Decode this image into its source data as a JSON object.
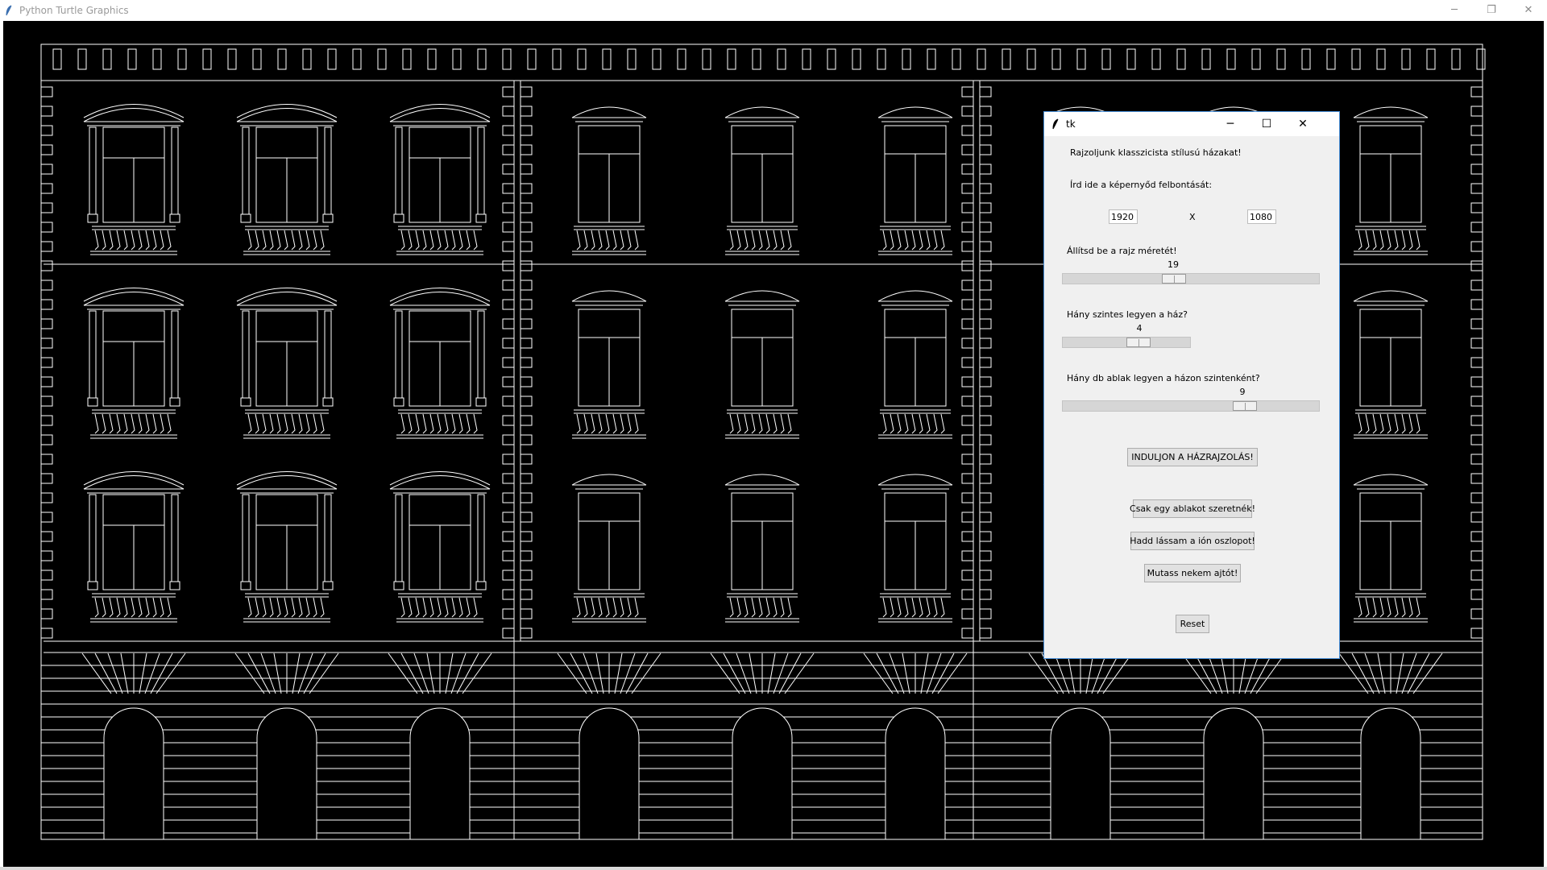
{
  "turtle_window": {
    "title": "Python Turtle Graphics"
  },
  "tk_window": {
    "title": "tk",
    "intro_label": "Rajzoljunk klasszicista stílusú házakat!",
    "resolution_label": "Írd ide a képernyőd felbontását:",
    "resolution_width": "1920",
    "resolution_separator": "X",
    "resolution_height": "1080",
    "size_label": "Állítsd be a rajz méretét!",
    "size_value": "19",
    "floors_label": "Hány szintes legyen a ház?",
    "floors_value": "4",
    "windows_label": "Hány db ablak legyen a házon szintenként?",
    "windows_value": "9",
    "start_button": "INDULJON A HÁZRAJZOLÁS!",
    "window_button": "Csak egy ablakot szeretnék!",
    "column_button": "Hadd lássam a ión oszlopot!",
    "door_button": "Mutass nekem ajtót!",
    "reset_button": "Reset"
  },
  "colors": {
    "canvas_bg": "#000000",
    "line": "#ffffff",
    "dialog_bg": "#f0f0f0"
  }
}
